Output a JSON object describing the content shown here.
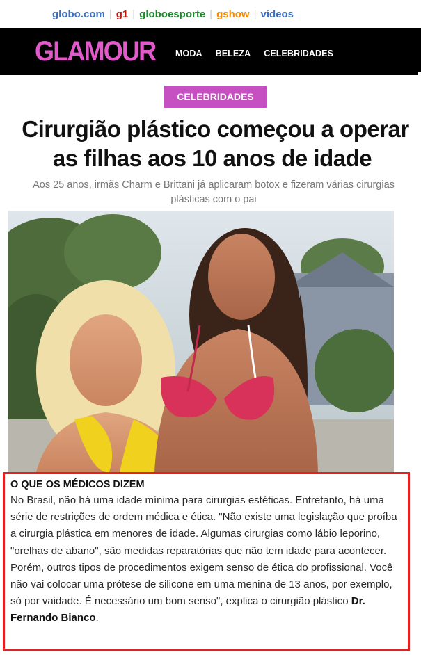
{
  "globo_bar": {
    "items": [
      "globo.com",
      "g1",
      "globoesporte",
      "gshow",
      "vídeos"
    ]
  },
  "header": {
    "logo": "GLAMOUR",
    "nav": [
      "MODA",
      "BELEZA",
      "CELEBRIDADES"
    ]
  },
  "article": {
    "category": "CELEBRIDADES",
    "headline_line1": "Cirurgião plástico começou a operar",
    "headline_line2": "as filhas aos 10 anos de idade",
    "subtitle_line1": "Aos 25 anos, irmãs Charm e Brittani já aplicaram botox e fizeram várias cirurgias",
    "subtitle_line2": "plásticas com o pai"
  },
  "doctors_box": {
    "title": "O QUE OS MÉDICOS DIZEM",
    "body": "No Brasil, não há uma idade mínima para cirurgias estéticas. Entretanto, há uma série de restrições de ordem médica e ética. \"Não existe uma legislação que proíba a cirurgia plástica em menores de idade. Algumas cirurgias como lábio leporino, \"orelhas de abano\", são medidas reparatórias que não tem idade para acontecer. Porém, outros tipos de procedimentos exigem senso de ética do profissional. Você não vai colocar uma prótese de silicone em uma menina de 13 anos, por exemplo, só por vaidade. É necessário um bom senso\", explica o cirurgião plástico",
    "doctor_name": "Dr. Fernando Bianco",
    "end_period": "."
  }
}
